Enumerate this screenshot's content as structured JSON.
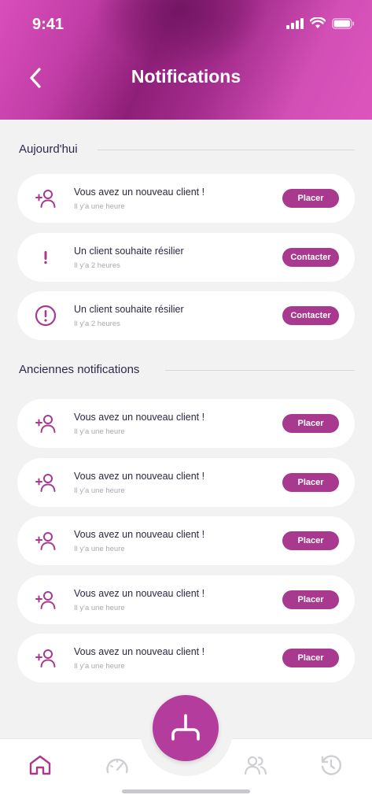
{
  "status_bar": {
    "time": "9:41"
  },
  "header": {
    "title": "Notifications"
  },
  "sections": [
    {
      "title": "Aujourd'hui",
      "items": [
        {
          "icon": "add-user-icon",
          "title": "Vous avez un nouveau client !",
          "time": "Il y'a une heure",
          "action": "Placer"
        },
        {
          "icon": "exclamation-icon",
          "title": "Un client souhaite résilier",
          "time": "Il y'a 2 heures",
          "action": "Contacter"
        },
        {
          "icon": "alert-circle-icon",
          "title": "Un client souhaite résilier",
          "time": "Il y'a 2 heures",
          "action": "Contacter"
        }
      ]
    },
    {
      "title": "Anciennes notifications",
      "items": [
        {
          "icon": "add-user-icon",
          "title": "Vous avez un nouveau client !",
          "time": "Il y'a une heure",
          "action": "Placer"
        },
        {
          "icon": "add-user-icon",
          "title": "Vous avez un nouveau client !",
          "time": "Il y'a une heure",
          "action": "Placer"
        },
        {
          "icon": "add-user-icon",
          "title": "Vous avez un nouveau client !",
          "time": "Il y'a une heure",
          "action": "Placer"
        },
        {
          "icon": "add-user-icon",
          "title": "Vous avez un nouveau client !",
          "time": "Il y'a une heure",
          "action": "Placer"
        },
        {
          "icon": "add-user-icon",
          "title": "Vous avez un nouveau client !",
          "time": "Il y'a une heure",
          "action": "Placer"
        }
      ]
    }
  ],
  "tab_bar": {
    "tabs": [
      {
        "name": "home-icon",
        "active": true
      },
      {
        "name": "speedometer-icon",
        "active": false
      },
      {
        "name": "users-icon",
        "active": false
      },
      {
        "name": "history-icon",
        "active": false
      }
    ],
    "center_action": "connector-icon"
  },
  "colors": {
    "accent": "#a8398f",
    "header_start": "#d94fbb",
    "header_dark": "#8e1f78",
    "background": "#f2f2f3",
    "text": "#2a2740",
    "muted": "#a9a9b0"
  }
}
